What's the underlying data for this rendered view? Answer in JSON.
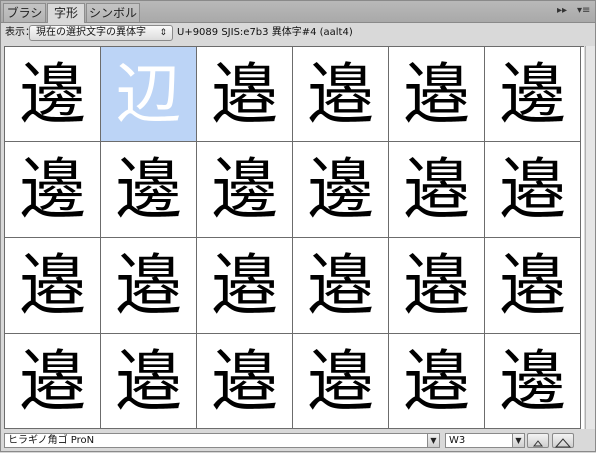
{
  "tabs": [
    {
      "label": "ブラシ"
    },
    {
      "label": "字形"
    },
    {
      "label": "シンボル"
    }
  ],
  "toolbar": {
    "show_label": "表示：",
    "filter_value": "現在の選択文字の異体字",
    "glyph_info": "U+9089 SJIS:e7b3 異体字#4 (aalt4)"
  },
  "glyphs": [
    "邊",
    "辺",
    "邉",
    "邉",
    "邉",
    "邊",
    "邊",
    "邊",
    "邊",
    "邊",
    "邉",
    "邉",
    "邉",
    "邉",
    "邉",
    "邉",
    "邉",
    "邉",
    "邉",
    "邉",
    "邉",
    "邉",
    "邉",
    "邊"
  ],
  "selected_index": 1,
  "font": {
    "family": "ヒラギノ角ゴ ProN",
    "style": "W3"
  },
  "icons": {
    "panel_menu": "panel-menu-icon",
    "collapse": "collapse-icon",
    "zoom_out": "zoom-out-icon",
    "zoom_in": "zoom-in-icon"
  },
  "colors": {
    "selection": "#bcd4f6",
    "grid_line": "#6c6c6c"
  }
}
